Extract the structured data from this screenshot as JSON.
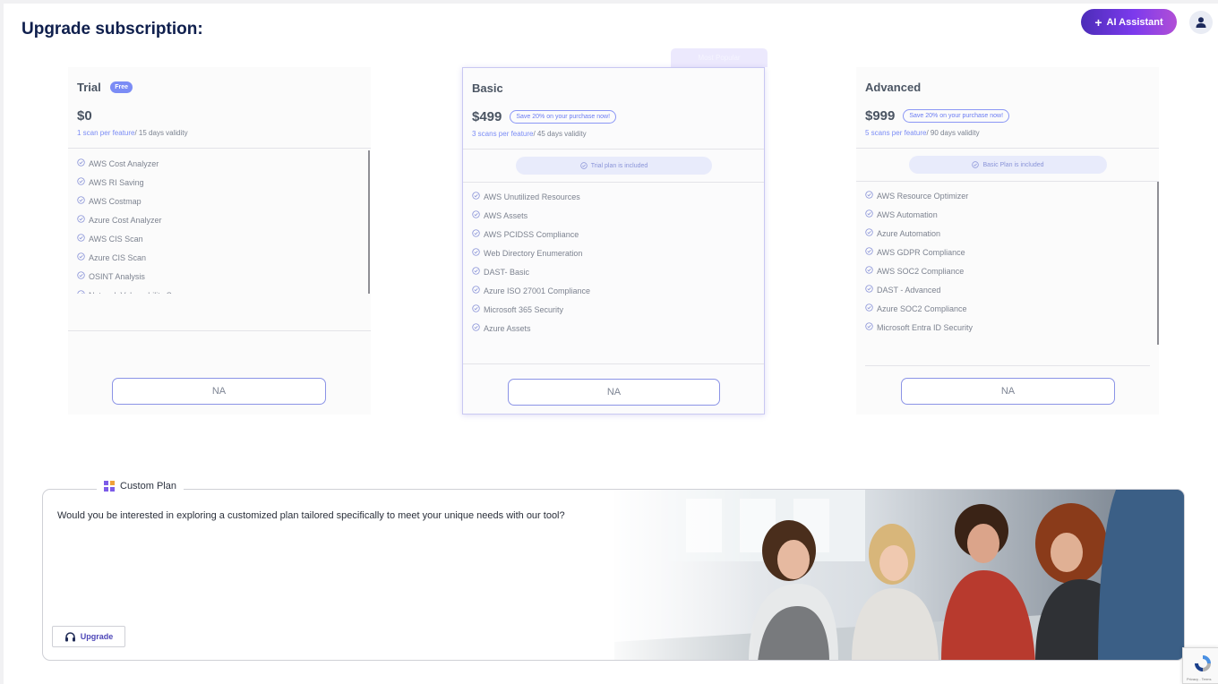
{
  "header": {
    "title": "Upgrade subscription:",
    "ai_button_label": "AI Assistant",
    "avatar_icon": "user-icon"
  },
  "popular_tag": "Most Popular",
  "plans": [
    {
      "name": "Trial",
      "badge": "Free",
      "price": "$0",
      "save_label": "",
      "scans": "1 scan per feature",
      "validity": "/ 15 days validity",
      "included": "",
      "features": [
        "AWS Cost Analyzer",
        "AWS RI Saving",
        "AWS Costmap",
        "Azure Cost Analyzer",
        "AWS CIS Scan",
        "Azure CIS Scan",
        "OSINT Analysis",
        "Network Vulnerability Scan"
      ],
      "button_label": "NA"
    },
    {
      "name": "Basic",
      "badge": "",
      "price": "$499",
      "save_label": "Save 20% on your purchase now!",
      "scans": "3 scans per feature",
      "validity": "/ 45 days validity",
      "included": "Trial plan is included",
      "features": [
        "AWS Unutilized Resources",
        "AWS Assets",
        "AWS PCIDSS Compliance",
        "Web Directory Enumeration",
        "DAST- Basic",
        "Azure ISO 27001 Compliance",
        "Microsoft 365 Security",
        "Azure Assets"
      ],
      "button_label": "NA"
    },
    {
      "name": "Advanced",
      "badge": "",
      "price": "$999",
      "save_label": "Save 20% on your purchase now!",
      "scans": "5 scans per feature",
      "validity": "/ 90 days validity",
      "included": "Basic Plan is included",
      "features": [
        "AWS Resource Optimizer",
        "AWS Automation",
        "Azure Automation",
        "AWS GDPR Compliance",
        "AWS SOC2 Compliance",
        "DAST - Advanced",
        "Azure SOC2 Compliance",
        "Microsoft Entra ID Security"
      ],
      "button_label": "NA"
    }
  ],
  "custom_plan": {
    "tab_label": "Custom Plan",
    "description": "Would you be interested in exploring a customized plan tailored specifically to meet your unique needs with our tool?",
    "upgrade_label": "Upgrade"
  },
  "recaptcha": {
    "text": "Privacy - Terms"
  },
  "colors": {
    "brand_dark": "#0f1f4d",
    "accent": "#6b7cf3",
    "ai_gradient_start": "#4c2db8",
    "ai_gradient_end": "#b14fd6"
  }
}
